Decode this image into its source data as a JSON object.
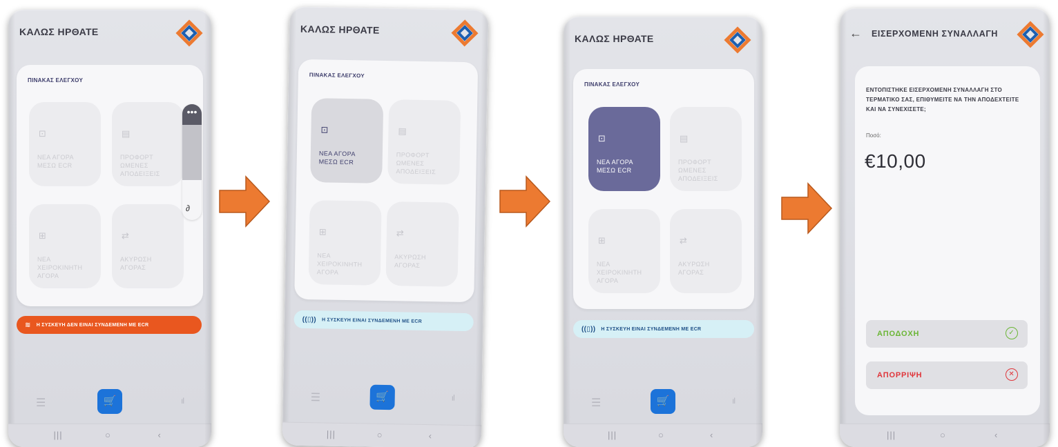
{
  "app": {
    "title": "ΚΑΛΩΣ ΗΡΘΑΤΕ",
    "dashboard_title": "ΠΙΝΑΚΑΣ ΕΛΕΓΧΟΥ",
    "tiles": {
      "new_ecr": "ΝΕΑ ΑΓΟΡΑ\nΜΕΣΩ ECR",
      "prefill": "ΠΡΟΦΟΡΤ\nΩΜΕΝΕΣ\nΑΠΟΔΕΙΞΕΙΣ",
      "manual": "ΝΕΑ\nΧΕΙΡΟΚΙΝΗΤΗ\nΑΓΟΡΑ",
      "cancel": "ΑΚΥΡΩΣΗ\nΑΓΟΡΑΣ"
    },
    "status_disconnected": "Η ΣΥΣΚΕΥΗ ΔΕΝ ΕΙΝΑΙ ΣΥΝΔΕΜΕΝΗ ΜΕ ECR",
    "status_connected": "Η ΣΥΣΚΕΥΗ ΕΙΝΑΙ ΣΥΝΔΕΜΕΝΗ ΜΕ ECR"
  },
  "transaction": {
    "title": "ΕΙΣΕΡΧΟΜΕΝΗ ΣΥΝΑΛΛΑΓΗ",
    "message": "ΕΝΤΟΠΙΣΤΗΚΕ ΕΙΣΕΡΧΟΜΕΝΗ ΣΥΝΑΛΛΑΓΗ ΣΤΟ ΤΕΡΜΑΤΙΚΟ ΣΑΣ, ΕΠΙΘΥΜΕΙΤΕ ΝΑ ΤΗΝ ΑΠΟΔΕΧΤΕΙΤΕ ΚΑΙ ΝΑ ΣΥΝΕΧΙΣΕΤΕ;",
    "amount_label": "Ποσό:",
    "amount": "€10,00",
    "accept": "ΑΠΟΔΟΧΗ",
    "reject": "ΑΠΟΡΡΙΨΗ"
  },
  "colors": {
    "accent_blue": "#1c73d9",
    "active_tile": "#6a6a9a",
    "error_banner": "#e9571f",
    "ok_banner": "#d6f0f6",
    "arrow": "#ec7a31",
    "accept": "#6bb636",
    "reject": "#e0353a"
  },
  "icons": {
    "back": "←",
    "menu_dots": "•••",
    "list": "☰",
    "cart": "🛒",
    "chart": "ıl",
    "recent": "|||",
    "home": "○",
    "sys_back": "‹",
    "tile_ecr": "⊡",
    "tile_receipt": "▤",
    "tile_cart": "⊞",
    "tile_repeat": "⇄",
    "check": "✓",
    "cross": "✕"
  }
}
